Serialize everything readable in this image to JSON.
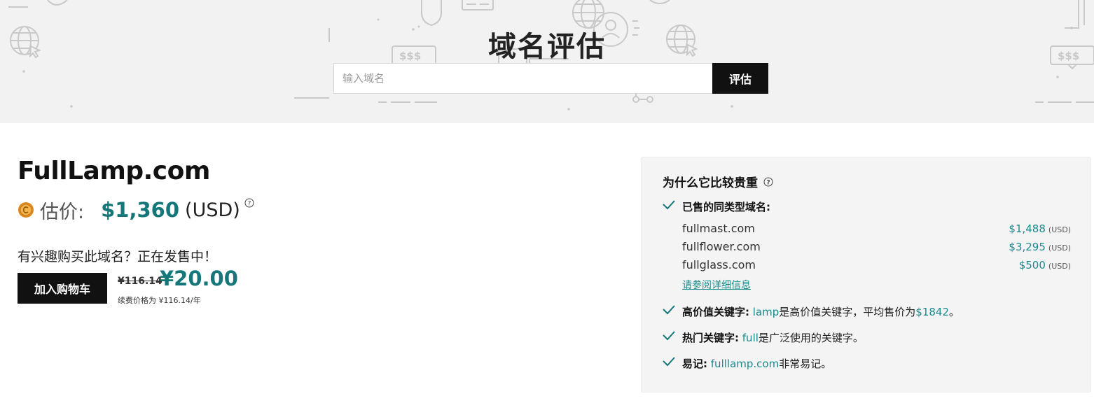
{
  "hero": {
    "title": "域名评估",
    "search": {
      "placeholder": "输入域名",
      "value": ""
    },
    "search_button": "评估"
  },
  "result": {
    "domain": "FullLamp.com",
    "estimate_label": "估价:",
    "estimate_value": "$1,360",
    "estimate_currency": "(USD)",
    "interest_text": "有兴趣购买此域名？正在发售中！",
    "add_to_cart": "加入购物车",
    "old_price": "¥116.14",
    "new_price": "¥20.00",
    "renew_note": "续费价格为 ¥116.14/年"
  },
  "why": {
    "title": "为什么它比较贵重",
    "sold_label": "已售的同类型域名:",
    "sold": [
      {
        "domain": "fullmast.com",
        "price": "$1,488",
        "unit": "(USD)"
      },
      {
        "domain": "fullflower.com",
        "price": "$3,295",
        "unit": "(USD)"
      },
      {
        "domain": "fullglass.com",
        "price": "$500",
        "unit": "(USD)"
      }
    ],
    "details_link": "请参阅详细信息",
    "reasons": [
      {
        "label": "高价值关键字:",
        "keyword": "lamp",
        "mid": " 是高价值关键字，平均售价为 ",
        "value": "$1842",
        "end": "。"
      },
      {
        "label": "热门关键字:",
        "keyword": "full",
        "mid": " 是广泛使用的关键字。",
        "value": "",
        "end": ""
      },
      {
        "label": "易记:",
        "keyword": "fulllamp.com",
        "mid": " 非常易记。",
        "value": "",
        "end": ""
      }
    ]
  },
  "colors": {
    "accent": "#16777a",
    "link": "#1a8a8c",
    "dark_button": "#111111",
    "hero_bg": "#f2f2f2"
  },
  "icons": [
    "globe-icon",
    "dollar-sign-icon",
    "shield-icon",
    "coin-icon",
    "help-icon",
    "check-icon"
  ]
}
